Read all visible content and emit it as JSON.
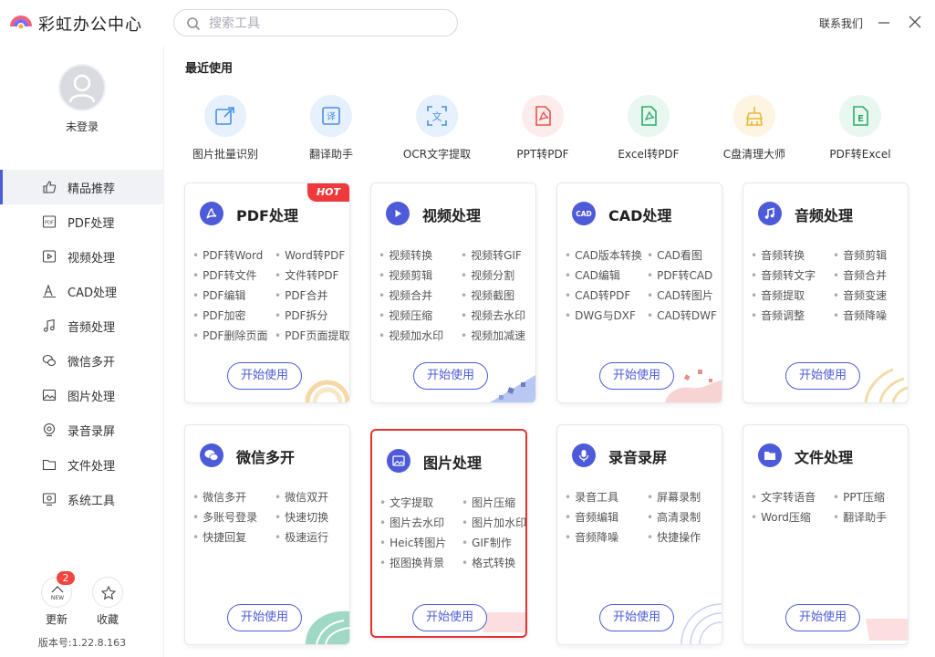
{
  "app": {
    "title": "彩虹办公中心",
    "contact": "联系我们"
  },
  "search": {
    "placeholder": "搜索工具"
  },
  "user": {
    "status": "未登录"
  },
  "sidebar": {
    "items": [
      {
        "label": "精品推荐",
        "icon": "thumb-up-icon"
      },
      {
        "label": "PDF处理",
        "icon": "pdf-icon"
      },
      {
        "label": "视频处理",
        "icon": "video-icon"
      },
      {
        "label": "CAD处理",
        "icon": "cad-icon"
      },
      {
        "label": "音频处理",
        "icon": "music-icon"
      },
      {
        "label": "微信多开",
        "icon": "wechat-icon"
      },
      {
        "label": "图片处理",
        "icon": "image-icon"
      },
      {
        "label": "录音录屏",
        "icon": "record-icon"
      },
      {
        "label": "文件处理",
        "icon": "folder-icon"
      },
      {
        "label": "系统工具",
        "icon": "system-icon"
      }
    ],
    "active_index": 0,
    "update_label": "更新",
    "update_badge": "2",
    "update_icon_text": "NEW",
    "favorite_label": "收藏",
    "version": "版本号:1.22.8.163"
  },
  "recent": {
    "title": "最近使用",
    "items": [
      {
        "label": "图片批量识别",
        "color": "#e6f1fd",
        "accent": "#4a90e2"
      },
      {
        "label": "翻译助手",
        "color": "#e6f1fd",
        "accent": "#4a90e2",
        "glyph": "译"
      },
      {
        "label": "OCR文字提取",
        "color": "#e6f1fd",
        "accent": "#4a90e2",
        "glyph": "文"
      },
      {
        "label": "PPT转PDF",
        "color": "#fdecec",
        "accent": "#e9544b"
      },
      {
        "label": "Excel转PDF",
        "color": "#e8f7ef",
        "accent": "#2fae69"
      },
      {
        "label": "C盘清理大师",
        "color": "#fdf5e2",
        "accent": "#e8b93a"
      },
      {
        "label": "PDF转Excel",
        "color": "#e8f7ef",
        "accent": "#2fae69",
        "glyph": "E"
      }
    ]
  },
  "cards": [
    {
      "title": "PDF处理",
      "icon": "pdf-icon",
      "hot": "HOT",
      "start": "开始使用",
      "features": [
        "PDF转Word",
        "Word转PDF",
        "PDF转文件",
        "文件转PDF",
        "PDF编辑",
        "PDF合并",
        "PDF加密",
        "PDF拆分",
        "PDF删除页面",
        "PDF页面提取"
      ]
    },
    {
      "title": "视频处理",
      "icon": "video-icon",
      "start": "开始使用",
      "features": [
        "视频转换",
        "视频转GIF",
        "视频剪辑",
        "视频分割",
        "视频合并",
        "视频截图",
        "视频压缩",
        "视频去水印",
        "视频加水印",
        "视频加减速"
      ]
    },
    {
      "title": "CAD处理",
      "icon": "cad-icon",
      "icon_text": "CAD",
      "start": "开始使用",
      "features": [
        "CAD版本转换",
        "CAD看图",
        "CAD编辑",
        "PDF转CAD",
        "CAD转PDF",
        "CAD转图片",
        "DWG与DXF",
        "CAD转DWF"
      ]
    },
    {
      "title": "音频处理",
      "icon": "music-icon",
      "start": "开始使用",
      "features": [
        "音频转换",
        "音频剪辑",
        "音频转文字",
        "音频合并",
        "音频提取",
        "音频变速",
        "音频调整",
        "音频降噪"
      ]
    },
    {
      "title": "微信多开",
      "icon": "wechat-icon",
      "start": "开始使用",
      "features": [
        "微信多开",
        "微信双开",
        "多账号登录",
        "快速切换",
        "快捷回复",
        "极速运行"
      ]
    },
    {
      "title": "图片处理",
      "icon": "image-icon",
      "start": "开始使用",
      "features": [
        "文字提取",
        "图片压缩",
        "图片去水印",
        "图片加水印",
        "Heic转图片",
        "GIF制作",
        "抠图换背景",
        "格式转换"
      ]
    },
    {
      "title": "录音录屏",
      "icon": "mic-icon",
      "start": "开始使用",
      "features": [
        "录音工具",
        "屏幕录制",
        "音频编辑",
        "高清录制",
        "音频降噪",
        "快捷操作"
      ]
    },
    {
      "title": "文件处理",
      "icon": "folder-icon",
      "start": "开始使用",
      "features": [
        "文字转语音",
        "PPT压缩",
        "Word压缩",
        "翻译助手"
      ]
    }
  ]
}
